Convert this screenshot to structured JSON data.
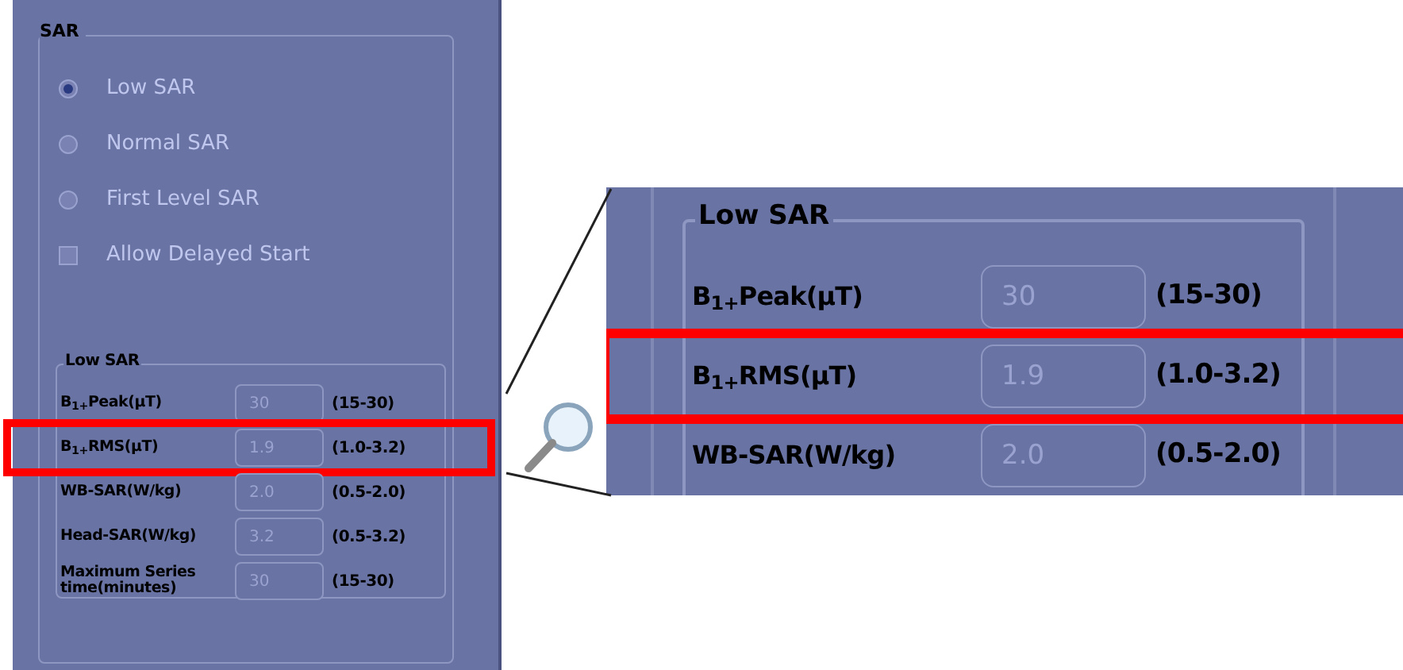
{
  "sar_group": {
    "title": "SAR",
    "options": [
      {
        "kind": "radio",
        "label": "Low SAR",
        "selected": true,
        "disabled": true
      },
      {
        "kind": "radio",
        "label": "Normal SAR",
        "selected": false,
        "disabled": true
      },
      {
        "kind": "radio",
        "label": "First Level SAR",
        "selected": false,
        "disabled": true
      },
      {
        "kind": "checkbox",
        "label": "Allow Delayed Start",
        "checked": false,
        "disabled": true
      }
    ]
  },
  "low_sar_group": {
    "title": "Low SAR",
    "rows": [
      {
        "label": "B$_{1+}$Peak(µT)",
        "value": "30",
        "range": "(15-30)",
        "highlighted": false
      },
      {
        "label": "B$_{1+}$RMS(µT)",
        "value": "1.9",
        "range": "(1.0-3.2)",
        "highlighted": true
      },
      {
        "label": "WB-SAR(W/kg)",
        "value": "2.0",
        "range": "(0.5-2.0)",
        "highlighted": false
      },
      {
        "label": "Head-SAR(W/kg)",
        "value": "3.2",
        "range": "(0.5-3.2)",
        "highlighted": false
      },
      {
        "label": "Maximum Series time(minutes)",
        "value": "30",
        "range": "(15-30)",
        "highlighted": false
      }
    ]
  },
  "zoom_inset": {
    "title": "Low SAR",
    "rows": [
      {
        "label": "B$_{1+}$Peak(µT)",
        "value": "30",
        "range": "(15-30)",
        "highlighted": false
      },
      {
        "label": "B$_{1+}$RMS(µT)",
        "value": "1.9",
        "range": "(1.0-3.2)",
        "highlighted": true
      },
      {
        "label": "WB-SAR(W/kg)",
        "value": "2.0",
        "range": "(0.5-2.0)",
        "highlighted": false
      }
    ]
  }
}
